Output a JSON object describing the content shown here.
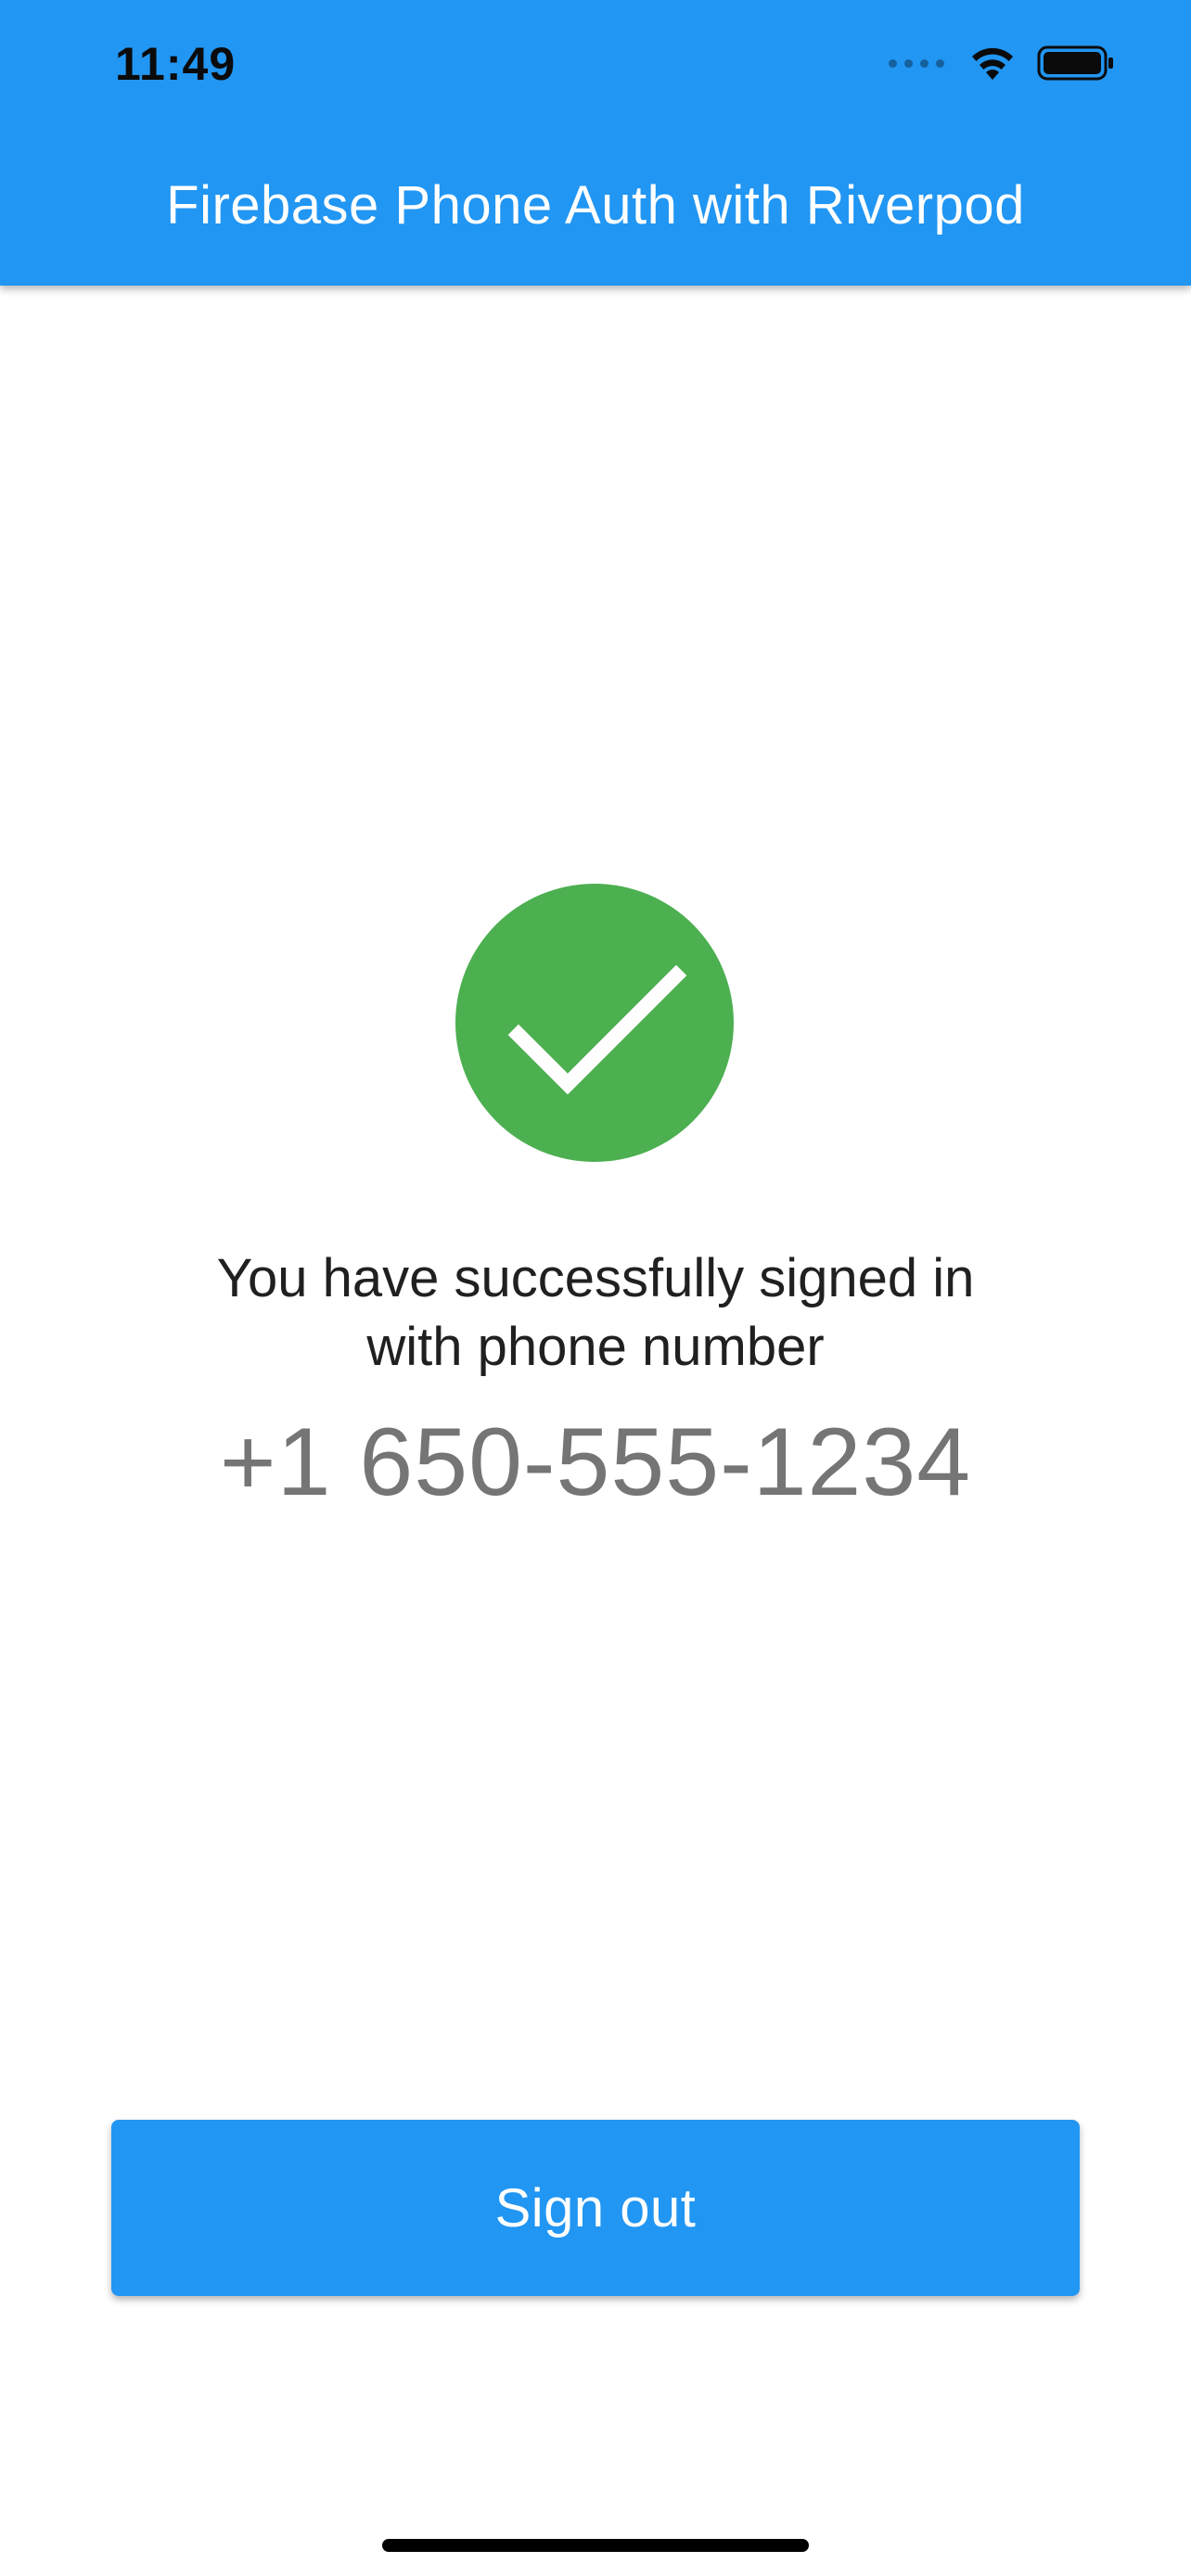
{
  "status_bar": {
    "time": "11:49",
    "icons": [
      "cellular-signal-icon",
      "wifi-icon",
      "battery-icon"
    ]
  },
  "app_bar": {
    "title": "Firebase Phone Auth with Riverpod",
    "color": "#2196f3"
  },
  "main": {
    "status_icon": "check-circle-icon",
    "status_color": "#4caf50",
    "message_line1": "You have successfully signed in",
    "message_line2": "with phone number",
    "phone_number": "+1 650-555-1234"
  },
  "actions": {
    "sign_out_label": "Sign out"
  }
}
